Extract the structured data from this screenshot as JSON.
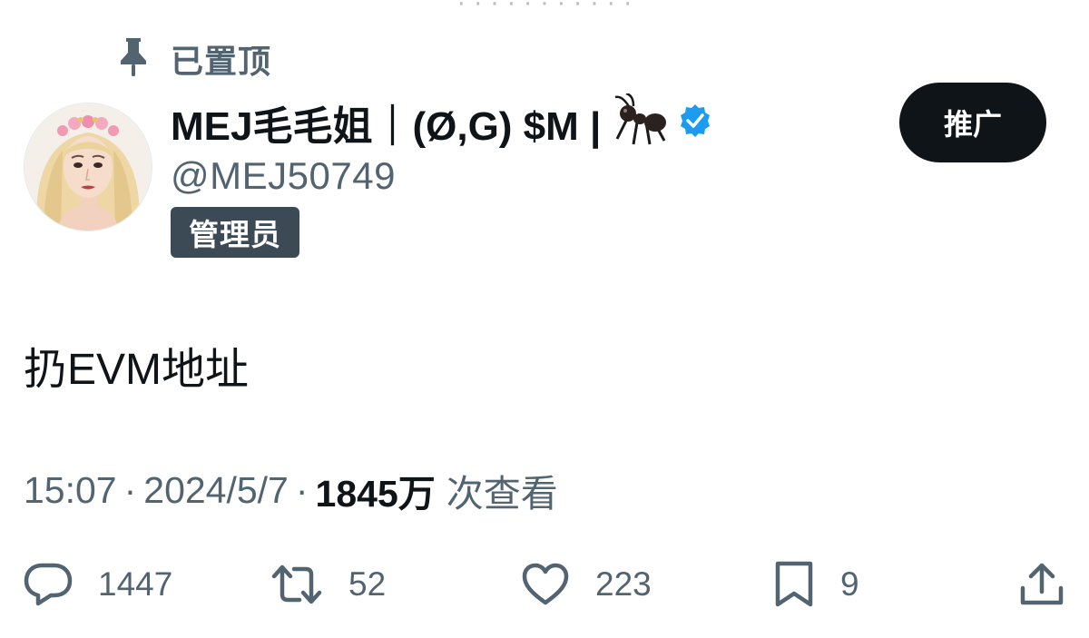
{
  "top_cut_text": "· · · · · · · · · · ·",
  "pinned": {
    "icon": "pin-icon",
    "label": "已置顶"
  },
  "author": {
    "display_name": "MEJ毛毛姐｜(Ø,G) $M |",
    "name_emoji": "🐜",
    "verified_icon": "verified-badge-icon",
    "handle": "@MEJ50749",
    "role_badge": "管理员"
  },
  "promote_button": {
    "label": "推广"
  },
  "tweet": {
    "text": "扔EVM地址"
  },
  "meta": {
    "time": "15:07",
    "separator": "·",
    "date": "2024/5/7",
    "views_count": "1845万",
    "views_label": "次查看"
  },
  "actions": {
    "reply": {
      "icon": "reply-icon",
      "count": "1447"
    },
    "retweet": {
      "icon": "retweet-icon",
      "count": "52"
    },
    "like": {
      "icon": "heart-icon",
      "count": "223"
    },
    "bookmark": {
      "icon": "bookmark-icon",
      "count": "9"
    },
    "share": {
      "icon": "share-icon"
    }
  },
  "colors": {
    "text_primary": "#0f1419",
    "text_secondary": "#536471",
    "verified_blue": "#1d9bf0",
    "button_bg": "#0f1419",
    "badge_bg": "#3b4a55"
  }
}
